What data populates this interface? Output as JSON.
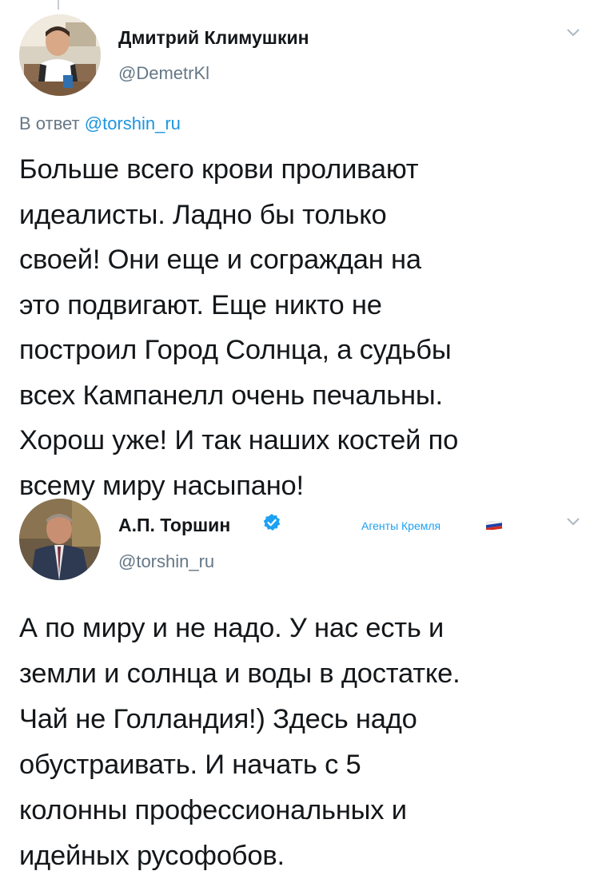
{
  "tweets": [
    {
      "author_name": "Дмитрий Климушкин",
      "handle": "@DemetrKl",
      "reply_prefix": "В ответ ",
      "reply_mention": "@torshin_ru",
      "text_lines": [
        "Больше всего крови проливают",
        "идеалисты. Ладно бы только",
        "своей! Они еще и сограждан на",
        "это подвигают. Еще никто не",
        "построил Город Солнца, а судьбы",
        "всех Кампанелл очень печальны.",
        "Хорош уже! И так наших костей по",
        "всему миру насыпано!"
      ]
    },
    {
      "author_name": "А.П. Торшин",
      "handle": "@torshin_ru",
      "label": "Агенты Кремля",
      "text_lines": [
        "А по миру и не надо. У нас есть и",
        "земли и солнца и воды в достатке.",
        "Чай не Голландия!) Здесь надо",
        "обустраивать. И начать с 5",
        "колонны профессиональных и",
        "идейных русофобов."
      ]
    }
  ],
  "icons": {
    "chevron": "chevron-down-icon",
    "verified": "verified-badge-icon",
    "flag": "russian-flag-icon"
  },
  "colors": {
    "text": "#14171a",
    "secondary": "#657786",
    "link": "#1b95e0",
    "verified": "#1da1f2"
  }
}
